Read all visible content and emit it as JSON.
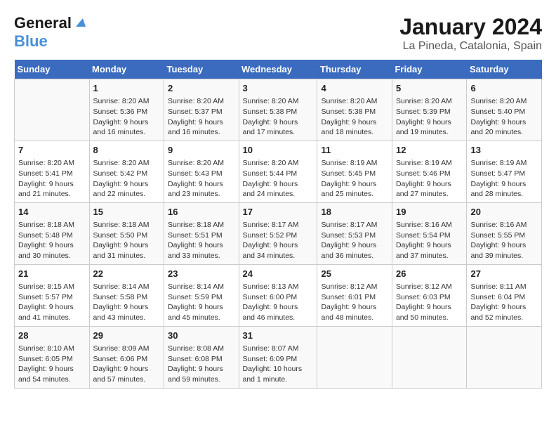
{
  "header": {
    "logo_line1": "General",
    "logo_line2": "Blue",
    "title": "January 2024",
    "subtitle": "La Pineda, Catalonia, Spain"
  },
  "weekdays": [
    "Sunday",
    "Monday",
    "Tuesday",
    "Wednesday",
    "Thursday",
    "Friday",
    "Saturday"
  ],
  "weeks": [
    [
      {
        "day": "",
        "info": ""
      },
      {
        "day": "1",
        "info": "Sunrise: 8:20 AM\nSunset: 5:36 PM\nDaylight: 9 hours\nand 16 minutes."
      },
      {
        "day": "2",
        "info": "Sunrise: 8:20 AM\nSunset: 5:37 PM\nDaylight: 9 hours\nand 16 minutes."
      },
      {
        "day": "3",
        "info": "Sunrise: 8:20 AM\nSunset: 5:38 PM\nDaylight: 9 hours\nand 17 minutes."
      },
      {
        "day": "4",
        "info": "Sunrise: 8:20 AM\nSunset: 5:38 PM\nDaylight: 9 hours\nand 18 minutes."
      },
      {
        "day": "5",
        "info": "Sunrise: 8:20 AM\nSunset: 5:39 PM\nDaylight: 9 hours\nand 19 minutes."
      },
      {
        "day": "6",
        "info": "Sunrise: 8:20 AM\nSunset: 5:40 PM\nDaylight: 9 hours\nand 20 minutes."
      }
    ],
    [
      {
        "day": "7",
        "info": "Sunrise: 8:20 AM\nSunset: 5:41 PM\nDaylight: 9 hours\nand 21 minutes."
      },
      {
        "day": "8",
        "info": "Sunrise: 8:20 AM\nSunset: 5:42 PM\nDaylight: 9 hours\nand 22 minutes."
      },
      {
        "day": "9",
        "info": "Sunrise: 8:20 AM\nSunset: 5:43 PM\nDaylight: 9 hours\nand 23 minutes."
      },
      {
        "day": "10",
        "info": "Sunrise: 8:20 AM\nSunset: 5:44 PM\nDaylight: 9 hours\nand 24 minutes."
      },
      {
        "day": "11",
        "info": "Sunrise: 8:19 AM\nSunset: 5:45 PM\nDaylight: 9 hours\nand 25 minutes."
      },
      {
        "day": "12",
        "info": "Sunrise: 8:19 AM\nSunset: 5:46 PM\nDaylight: 9 hours\nand 27 minutes."
      },
      {
        "day": "13",
        "info": "Sunrise: 8:19 AM\nSunset: 5:47 PM\nDaylight: 9 hours\nand 28 minutes."
      }
    ],
    [
      {
        "day": "14",
        "info": "Sunrise: 8:18 AM\nSunset: 5:48 PM\nDaylight: 9 hours\nand 30 minutes."
      },
      {
        "day": "15",
        "info": "Sunrise: 8:18 AM\nSunset: 5:50 PM\nDaylight: 9 hours\nand 31 minutes."
      },
      {
        "day": "16",
        "info": "Sunrise: 8:18 AM\nSunset: 5:51 PM\nDaylight: 9 hours\nand 33 minutes."
      },
      {
        "day": "17",
        "info": "Sunrise: 8:17 AM\nSunset: 5:52 PM\nDaylight: 9 hours\nand 34 minutes."
      },
      {
        "day": "18",
        "info": "Sunrise: 8:17 AM\nSunset: 5:53 PM\nDaylight: 9 hours\nand 36 minutes."
      },
      {
        "day": "19",
        "info": "Sunrise: 8:16 AM\nSunset: 5:54 PM\nDaylight: 9 hours\nand 37 minutes."
      },
      {
        "day": "20",
        "info": "Sunrise: 8:16 AM\nSunset: 5:55 PM\nDaylight: 9 hours\nand 39 minutes."
      }
    ],
    [
      {
        "day": "21",
        "info": "Sunrise: 8:15 AM\nSunset: 5:57 PM\nDaylight: 9 hours\nand 41 minutes."
      },
      {
        "day": "22",
        "info": "Sunrise: 8:14 AM\nSunset: 5:58 PM\nDaylight: 9 hours\nand 43 minutes."
      },
      {
        "day": "23",
        "info": "Sunrise: 8:14 AM\nSunset: 5:59 PM\nDaylight: 9 hours\nand 45 minutes."
      },
      {
        "day": "24",
        "info": "Sunrise: 8:13 AM\nSunset: 6:00 PM\nDaylight: 9 hours\nand 46 minutes."
      },
      {
        "day": "25",
        "info": "Sunrise: 8:12 AM\nSunset: 6:01 PM\nDaylight: 9 hours\nand 48 minutes."
      },
      {
        "day": "26",
        "info": "Sunrise: 8:12 AM\nSunset: 6:03 PM\nDaylight: 9 hours\nand 50 minutes."
      },
      {
        "day": "27",
        "info": "Sunrise: 8:11 AM\nSunset: 6:04 PM\nDaylight: 9 hours\nand 52 minutes."
      }
    ],
    [
      {
        "day": "28",
        "info": "Sunrise: 8:10 AM\nSunset: 6:05 PM\nDaylight: 9 hours\nand 54 minutes."
      },
      {
        "day": "29",
        "info": "Sunrise: 8:09 AM\nSunset: 6:06 PM\nDaylight: 9 hours\nand 57 minutes."
      },
      {
        "day": "30",
        "info": "Sunrise: 8:08 AM\nSunset: 6:08 PM\nDaylight: 9 hours\nand 59 minutes."
      },
      {
        "day": "31",
        "info": "Sunrise: 8:07 AM\nSunset: 6:09 PM\nDaylight: 10 hours\nand 1 minute."
      },
      {
        "day": "",
        "info": ""
      },
      {
        "day": "",
        "info": ""
      },
      {
        "day": "",
        "info": ""
      }
    ]
  ]
}
